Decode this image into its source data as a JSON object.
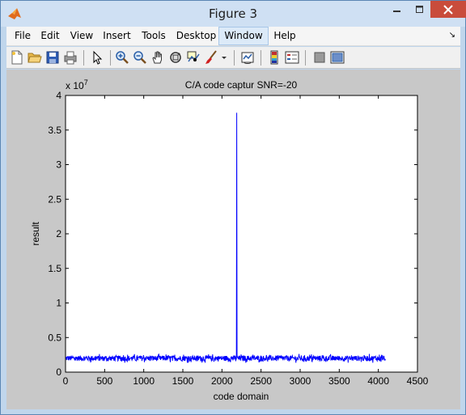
{
  "window": {
    "title": "Figure 3"
  },
  "menu": [
    {
      "id": "file",
      "label": "File"
    },
    {
      "id": "edit",
      "label": "Edit"
    },
    {
      "id": "view",
      "label": "View"
    },
    {
      "id": "insert",
      "label": "Insert"
    },
    {
      "id": "tools",
      "label": "Tools"
    },
    {
      "id": "desktop",
      "label": "Desktop"
    },
    {
      "id": "window",
      "label": "Window"
    },
    {
      "id": "help",
      "label": "Help"
    }
  ],
  "toolbar": [
    "new-figure-icon",
    "open-file-icon",
    "save-icon",
    "print-icon",
    "pointer-icon",
    "zoom-in-icon",
    "zoom-out-icon",
    "pan-hand-icon",
    "rotate-3d-icon",
    "data-cursor-icon",
    "brush-icon",
    "link-plot-icon",
    "colorbar-icon",
    "legend-icon",
    "hide-plot-tools-icon",
    "show-plot-tools-icon"
  ],
  "chart_data": {
    "type": "line",
    "title": "C/A code captur SNR=-20",
    "xlabel": "code domain",
    "ylabel": "result",
    "y_exponent": "x 10",
    "y_exponent_power": "7",
    "xlim": [
      0,
      4500
    ],
    "ylim": [
      0,
      4
    ],
    "xticks": [
      0,
      500,
      1000,
      1500,
      2000,
      2500,
      3000,
      3500,
      4000,
      4500
    ],
    "yticks": [
      0,
      0.5,
      1,
      1.5,
      2,
      2.5,
      3,
      3.5,
      4
    ],
    "series": [
      {
        "color": "#0000ff",
        "x_range": [
          1,
          4092
        ],
        "noise_floor_mean": 0.2,
        "noise_floor_range": [
          0.15,
          0.28
        ],
        "peak_x": 2190,
        "peak_y": 3.75
      }
    ],
    "grid": false
  }
}
